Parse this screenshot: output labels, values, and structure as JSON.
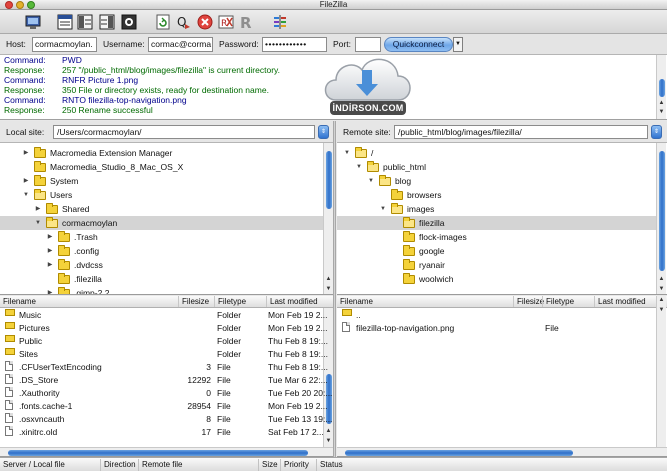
{
  "window": {
    "title": "FileZilla"
  },
  "toolbar": {
    "buttons": [
      "site-manager-icon",
      "message-log-toggle-icon",
      "local-tree-toggle-icon",
      "remote-tree-toggle-icon",
      "queue-toggle-icon",
      "refresh-icon",
      "process-queue-icon",
      "cancel-icon",
      "disconnect-icon",
      "reconnect-icon",
      "compare-icon"
    ]
  },
  "quickconnect": {
    "host_label": "Host:",
    "host_value": "cormacmoylan.",
    "username_label": "Username:",
    "username_value": "cormac@corma",
    "password_label": "Password:",
    "password_value": "••••••••••••",
    "port_label": "Port:",
    "port_value": "",
    "button_label": "Quickconnect",
    "dropdown_glyph": "▼"
  },
  "log": [
    {
      "kind": "Command:",
      "type": "command",
      "msg": "PWD"
    },
    {
      "kind": "Response:",
      "type": "response",
      "msg": "257 \"/public_html/blog/images/filezilla\" is current directory."
    },
    {
      "kind": "Command:",
      "type": "command",
      "msg": "RNFR Picture 1.png"
    },
    {
      "kind": "Response:",
      "type": "response",
      "msg": "350 File or directory exists, ready for destination name."
    },
    {
      "kind": "Command:",
      "type": "command",
      "msg": "RNTO filezilla-top-navigation.png"
    },
    {
      "kind": "Response:",
      "type": "response",
      "msg": "250 Rename successful"
    }
  ],
  "watermark": {
    "text": "İNDİRSON.COM"
  },
  "local": {
    "site_label": "Local site:",
    "path": "/Users/cormacmoylan/",
    "tree": [
      {
        "label": "Macromedia Extension Manager",
        "depth": 1,
        "expander": "▶",
        "open": false,
        "selected": false
      },
      {
        "label": "Macromedia_Studio_8_Mac_OS_X",
        "depth": 1,
        "expander": "",
        "open": false,
        "selected": false
      },
      {
        "label": "System",
        "depth": 1,
        "expander": "▶",
        "open": false,
        "selected": false
      },
      {
        "label": "Users",
        "depth": 1,
        "expander": "▼",
        "open": true,
        "selected": false
      },
      {
        "label": "Shared",
        "depth": 2,
        "expander": "▶",
        "open": false,
        "selected": false
      },
      {
        "label": "cormacmoylan",
        "depth": 2,
        "expander": "▼",
        "open": true,
        "selected": true
      },
      {
        "label": ".Trash",
        "depth": 3,
        "expander": "▶",
        "open": false,
        "selected": false
      },
      {
        "label": ".config",
        "depth": 3,
        "expander": "▶",
        "open": false,
        "selected": false
      },
      {
        "label": ".dvdcss",
        "depth": 3,
        "expander": "▶",
        "open": false,
        "selected": false
      },
      {
        "label": ".filezilla",
        "depth": 3,
        "expander": "",
        "open": false,
        "selected": false
      },
      {
        "label": ".gimp-2.2",
        "depth": 3,
        "expander": "▶",
        "open": false,
        "selected": false
      }
    ],
    "columns": [
      "Filename",
      "Filesize",
      "Filetype",
      "Last modified"
    ],
    "files": [
      {
        "name": "Music",
        "size": "",
        "type": "Folder",
        "modified": "Mon Feb 19 2...",
        "icon": "folder"
      },
      {
        "name": "Pictures",
        "size": "",
        "type": "Folder",
        "modified": "Mon Feb 19 2...",
        "icon": "folder"
      },
      {
        "name": "Public",
        "size": "",
        "type": "Folder",
        "modified": "Thu Feb 8 19:...",
        "icon": "folder"
      },
      {
        "name": "Sites",
        "size": "",
        "type": "Folder",
        "modified": "Thu Feb 8 19:...",
        "icon": "folder"
      },
      {
        "name": ".CFUserTextEncoding",
        "size": "3",
        "type": "File",
        "modified": "Thu Feb 8 19:...",
        "icon": "file"
      },
      {
        "name": ".DS_Store",
        "size": "12292",
        "type": "File",
        "modified": "Tue Mar 6 22:...",
        "icon": "file"
      },
      {
        "name": ".Xauthority",
        "size": "0",
        "type": "File",
        "modified": "Tue Feb 20 20:...",
        "icon": "file"
      },
      {
        "name": ".fonts.cache-1",
        "size": "28954",
        "type": "File",
        "modified": "Mon Feb 19 2...",
        "icon": "file"
      },
      {
        "name": ".osxvncauth",
        "size": "8",
        "type": "File",
        "modified": "Tue Feb 13 19:...",
        "icon": "file"
      },
      {
        "name": ".xinitrc.old",
        "size": "17",
        "type": "File",
        "modified": "Sat Feb 17 2...",
        "icon": "file"
      }
    ]
  },
  "remote": {
    "site_label": "Remote site:",
    "path": "/public_html/blog/images/filezilla/",
    "tree": [
      {
        "label": "/",
        "depth": 0,
        "expander": "▼",
        "open": true,
        "selected": false
      },
      {
        "label": "public_html",
        "depth": 1,
        "expander": "▼",
        "open": true,
        "selected": false
      },
      {
        "label": "blog",
        "depth": 2,
        "expander": "▼",
        "open": true,
        "selected": false
      },
      {
        "label": "browsers",
        "depth": 3,
        "expander": "",
        "open": false,
        "selected": false
      },
      {
        "label": "images",
        "depth": 3,
        "expander": "▼",
        "open": true,
        "selected": false
      },
      {
        "label": "filezilla",
        "depth": 4,
        "expander": "",
        "open": true,
        "selected": true
      },
      {
        "label": "flock-images",
        "depth": 4,
        "expander": "",
        "open": false,
        "selected": false
      },
      {
        "label": "google",
        "depth": 4,
        "expander": "",
        "open": false,
        "selected": false
      },
      {
        "label": "ryanair",
        "depth": 4,
        "expander": "",
        "open": false,
        "selected": false
      },
      {
        "label": "woolwich",
        "depth": 4,
        "expander": "",
        "open": false,
        "selected": false
      }
    ],
    "columns": [
      "Filename",
      "Filesize",
      "Filetype",
      "Last modified"
    ],
    "files": [
      {
        "name": "..",
        "size": "",
        "type": "",
        "modified": "",
        "icon": "folder"
      },
      {
        "name": "filezilla-top-navigation.png",
        "size": "",
        "type": "File",
        "modified": "",
        "icon": "file"
      }
    ]
  },
  "queue": {
    "columns": [
      "Server / Local file",
      "Direction",
      "Remote file",
      "Size",
      "Priority",
      "Status"
    ]
  },
  "colors": {
    "command": "#00008b",
    "response": "#006a00",
    "accent": "#2f6fc9",
    "folder": "#f4d23a"
  }
}
